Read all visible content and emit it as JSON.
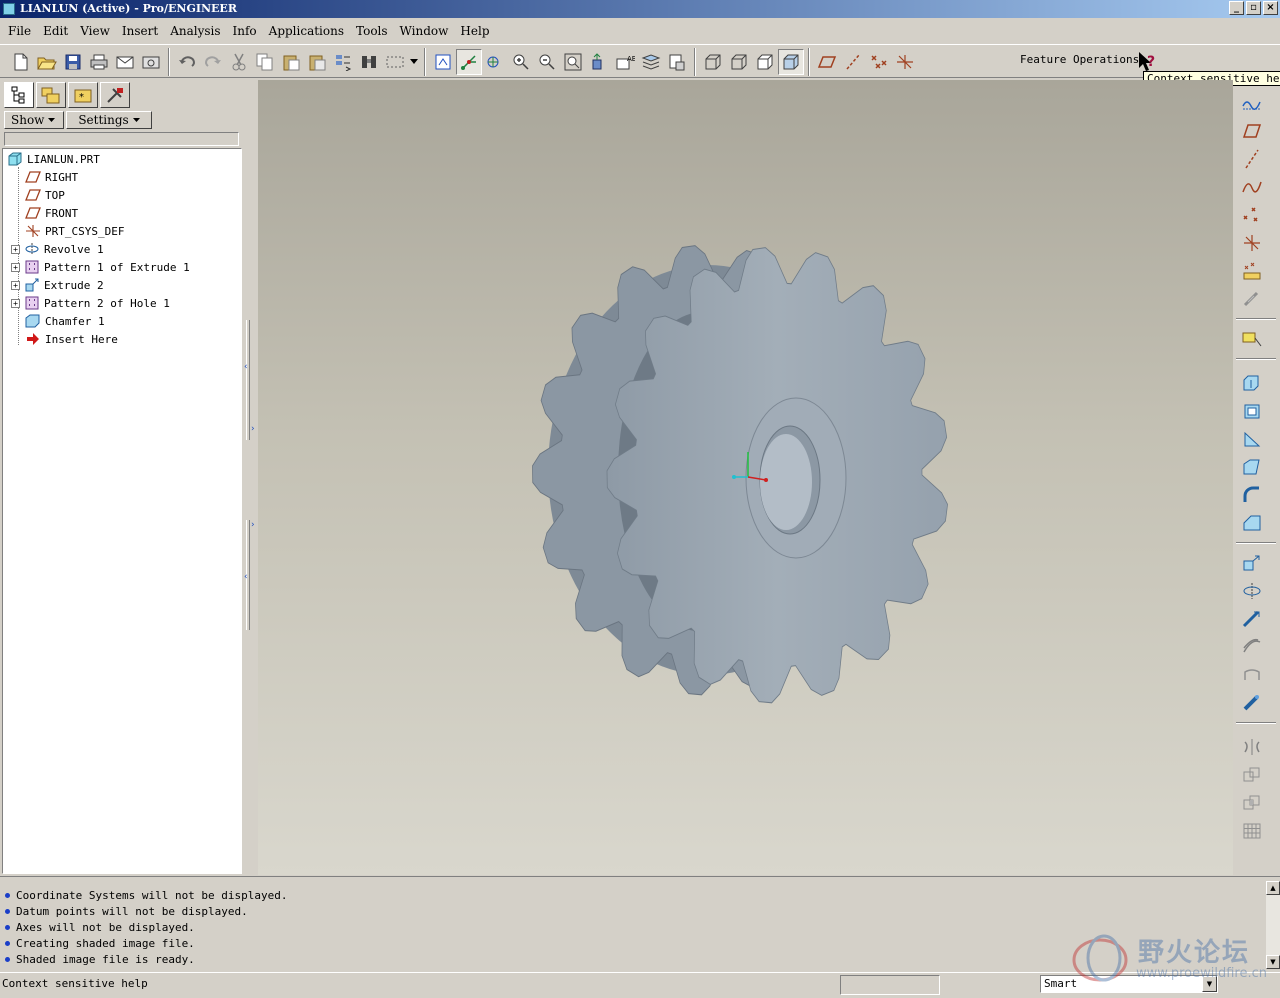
{
  "window": {
    "title": "LIANLUN (Active) - Pro/ENGINEER"
  },
  "menu": [
    "File",
    "Edit",
    "View",
    "Insert",
    "Analysis",
    "Info",
    "Applications",
    "Tools",
    "Window",
    "Help"
  ],
  "toolbar": {
    "feature_operations_label": "Feature Operations",
    "tooltip": "Context sensitive help",
    "icons": [
      "new-icon",
      "open-icon",
      "save-icon",
      "print-icon",
      "email-icon",
      "email-link-icon",
      "undo-icon",
      "redo-icon",
      "cut-icon",
      "copy-icon",
      "paste-icon",
      "paste-special-icon",
      "regenerate-icon",
      "find-icon",
      "select-box-icon",
      "repaint-icon",
      "spin-center-icon",
      "orient-mode-icon",
      "zoom-in-icon",
      "zoom-out-icon",
      "refit-icon",
      "reorient-icon",
      "saved-views-icon",
      "layers-icon",
      "view-manager-icon",
      "wireframe-icon",
      "hidden-line-icon",
      "no-hidden-icon",
      "shading-icon",
      "datum-planes-toggle-icon",
      "datum-axes-toggle-icon",
      "datum-points-toggle-icon",
      "csys-toggle-icon",
      "context-help-icon"
    ]
  },
  "model_tree": {
    "show_label": "Show",
    "settings_label": "Settings",
    "items": [
      {
        "label": "LIANLUN.PRT",
        "icon": "part-icon",
        "expandable": false
      },
      {
        "label": "RIGHT",
        "icon": "datum-plane-icon",
        "expandable": false
      },
      {
        "label": "TOP",
        "icon": "datum-plane-icon",
        "expandable": false
      },
      {
        "label": "FRONT",
        "icon": "datum-plane-icon",
        "expandable": false
      },
      {
        "label": "PRT_CSYS_DEF",
        "icon": "csys-icon",
        "expandable": false
      },
      {
        "label": "Revolve 1",
        "icon": "revolve-icon",
        "expandable": true
      },
      {
        "label": "Pattern 1 of Extrude 1",
        "icon": "pattern-icon",
        "expandable": true
      },
      {
        "label": "Extrude 2",
        "icon": "extrude-icon",
        "expandable": true
      },
      {
        "label": "Pattern 2 of Hole 1",
        "icon": "pattern-icon",
        "expandable": true
      },
      {
        "label": "Chamfer 1",
        "icon": "chamfer-icon",
        "expandable": false
      },
      {
        "label": "Insert Here",
        "icon": "insert-arrow-icon",
        "expandable": false
      }
    ]
  },
  "messages": [
    "Coordinate Systems will not be displayed.",
    "Datum points will not be displayed.",
    "Axes will not be displayed.",
    "Creating shaded image file.",
    "Shaded image file is ready."
  ],
  "status": {
    "text": "Context sensitive help",
    "filter_value": "Smart"
  },
  "watermark": {
    "text": "野火论坛",
    "url": "www.proewildfire.cn"
  },
  "colors": {
    "model": "#9aa6b2",
    "background_top": "#a9a69a",
    "background_bottom": "#d9d7cd",
    "title_bar": "#0a246a"
  }
}
